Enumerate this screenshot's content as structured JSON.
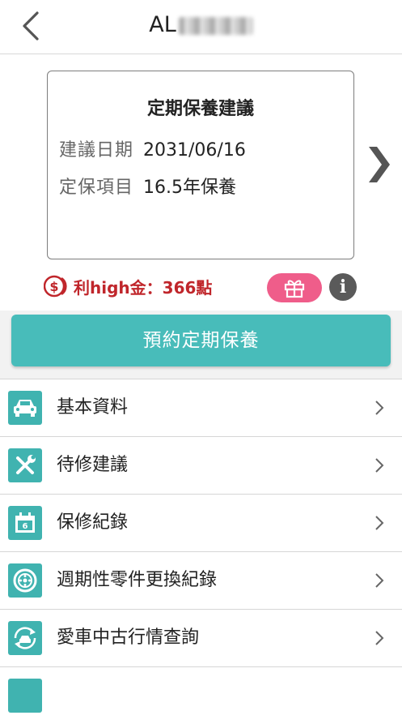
{
  "header": {
    "plate_prefix": "AL",
    "back_icon": "chevron-left-icon"
  },
  "card": {
    "title": "定期保養建議",
    "date_label": "建議日期",
    "date_value": "2031/06/16",
    "item_label": "定保項目",
    "item_value": "16.5年保養"
  },
  "points": {
    "text": "利high金：366點",
    "coin_icon": "coin-dollar-icon"
  },
  "actions": {
    "gift_icon": "gift-icon",
    "info_icon": "info-icon",
    "info_glyph": "i"
  },
  "book_button": {
    "label": "預約定期保養"
  },
  "menu": {
    "items": [
      {
        "label": "基本資料",
        "icon": "car-icon"
      },
      {
        "label": "待修建議",
        "icon": "tools-icon"
      },
      {
        "label": "保修紀錄",
        "icon": "calendar-icon"
      },
      {
        "label": "週期性零件更換紀錄",
        "icon": "wheel-icon"
      },
      {
        "label": "愛車中古行情查詢",
        "icon": "car-refresh-icon"
      }
    ]
  },
  "colors": {
    "teal": "#48bcba",
    "icon_teal": "#40b3b0",
    "points_red": "#c0262b",
    "gift_pink": "#ef5d8a"
  }
}
